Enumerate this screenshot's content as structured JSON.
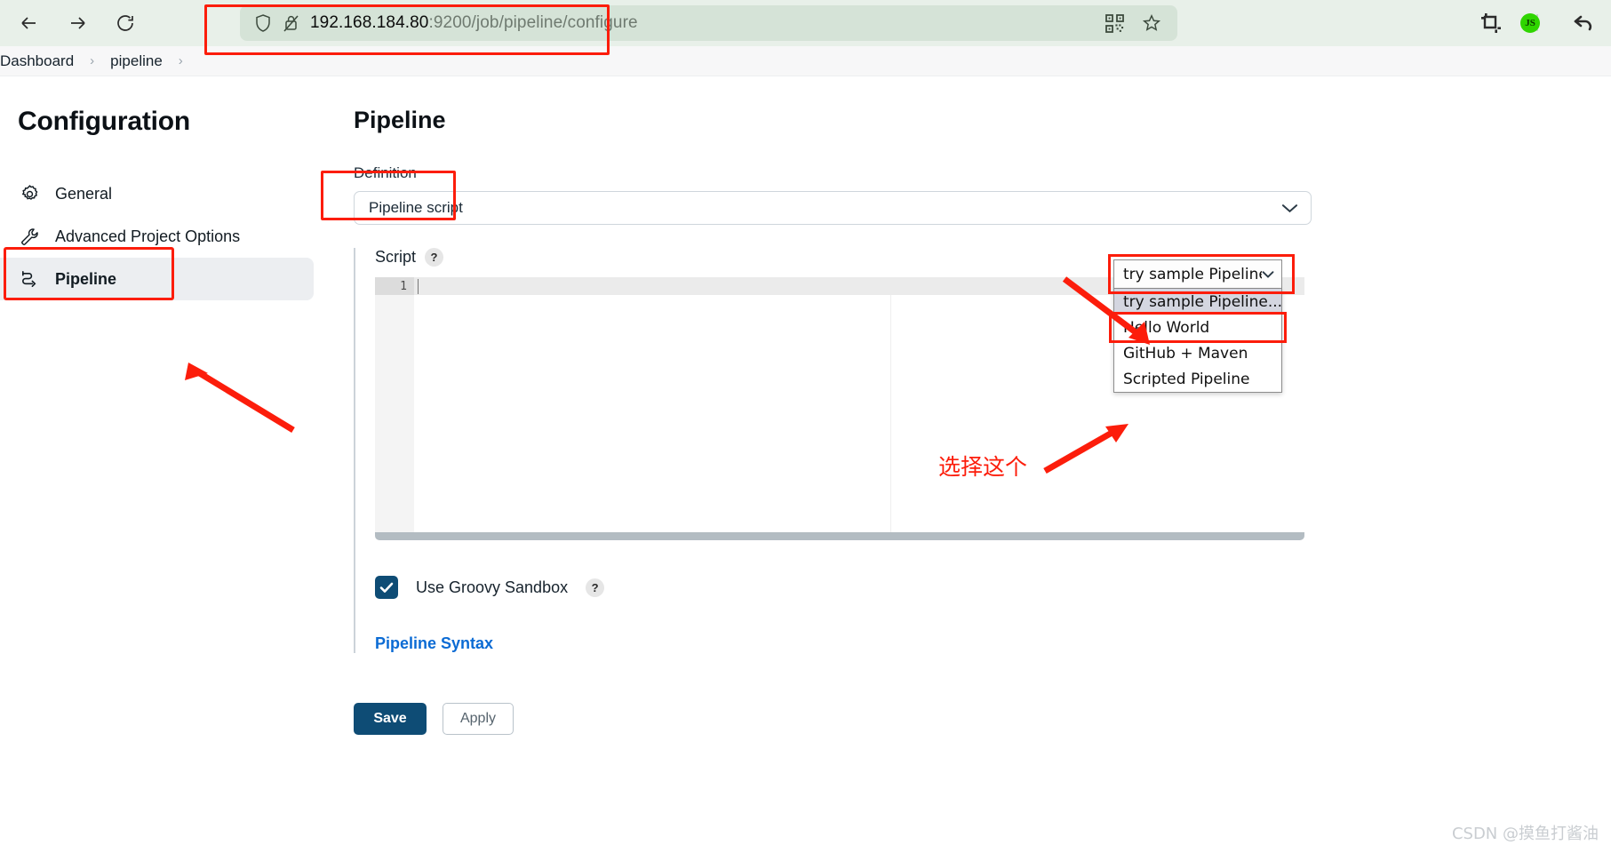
{
  "browser": {
    "back_label": "back-arrow",
    "forward_label": "forward-arrow",
    "reload_label": "reload",
    "url_host": "192.168.184.80",
    "url_path": ":9200/job/pipeline/configure",
    "url_full": "192.168.184.80:9200/job/pipeline/configure",
    "icons": {
      "shield": "shield-icon",
      "lock_crossed": "lock-crossed-icon",
      "qr": "qr-code-icon",
      "bookmark": "star-bookmark-icon",
      "crop": "crop-icon",
      "js_toggle": "javascript-toggle",
      "js_label": "JS",
      "undo": "undo-arrow-icon"
    }
  },
  "breadcrumb": {
    "items": [
      {
        "label": "Dashboard"
      },
      {
        "label": "pipeline"
      }
    ],
    "separator": "›"
  },
  "sidebar": {
    "title": "Configuration",
    "items": [
      {
        "label": "General",
        "icon": "gear-icon"
      },
      {
        "label": "Advanced Project Options",
        "icon": "wrench-icon"
      },
      {
        "label": "Pipeline",
        "icon": "pipeline-icon",
        "active": true
      }
    ]
  },
  "main": {
    "title": "Pipeline",
    "definition_label": "Definition",
    "definition_value": "Pipeline script",
    "script_label": "Script",
    "help_badge": "?",
    "editor": {
      "line_number": "1",
      "content": ""
    },
    "sandbox": {
      "label": "Use Groovy Sandbox",
      "checked": true,
      "help_badge": "?"
    },
    "pipeline_syntax_link": "Pipeline Syntax",
    "buttons": {
      "save": "Save",
      "apply": "Apply"
    }
  },
  "sample_dropdown": {
    "selected": "try sample Pipeline...",
    "options": [
      {
        "label": "try sample Pipeline...",
        "highlighted": true
      },
      {
        "label": "Hello World",
        "highlighted": false
      },
      {
        "label": "GitHub + Maven",
        "highlighted": false
      },
      {
        "label": "Scripted Pipeline",
        "highlighted": false
      }
    ]
  },
  "annotations": {
    "chinese_note": "选择这个",
    "accent_color": "#fc1d0b"
  },
  "watermark": "CSDN @摸鱼打酱油"
}
